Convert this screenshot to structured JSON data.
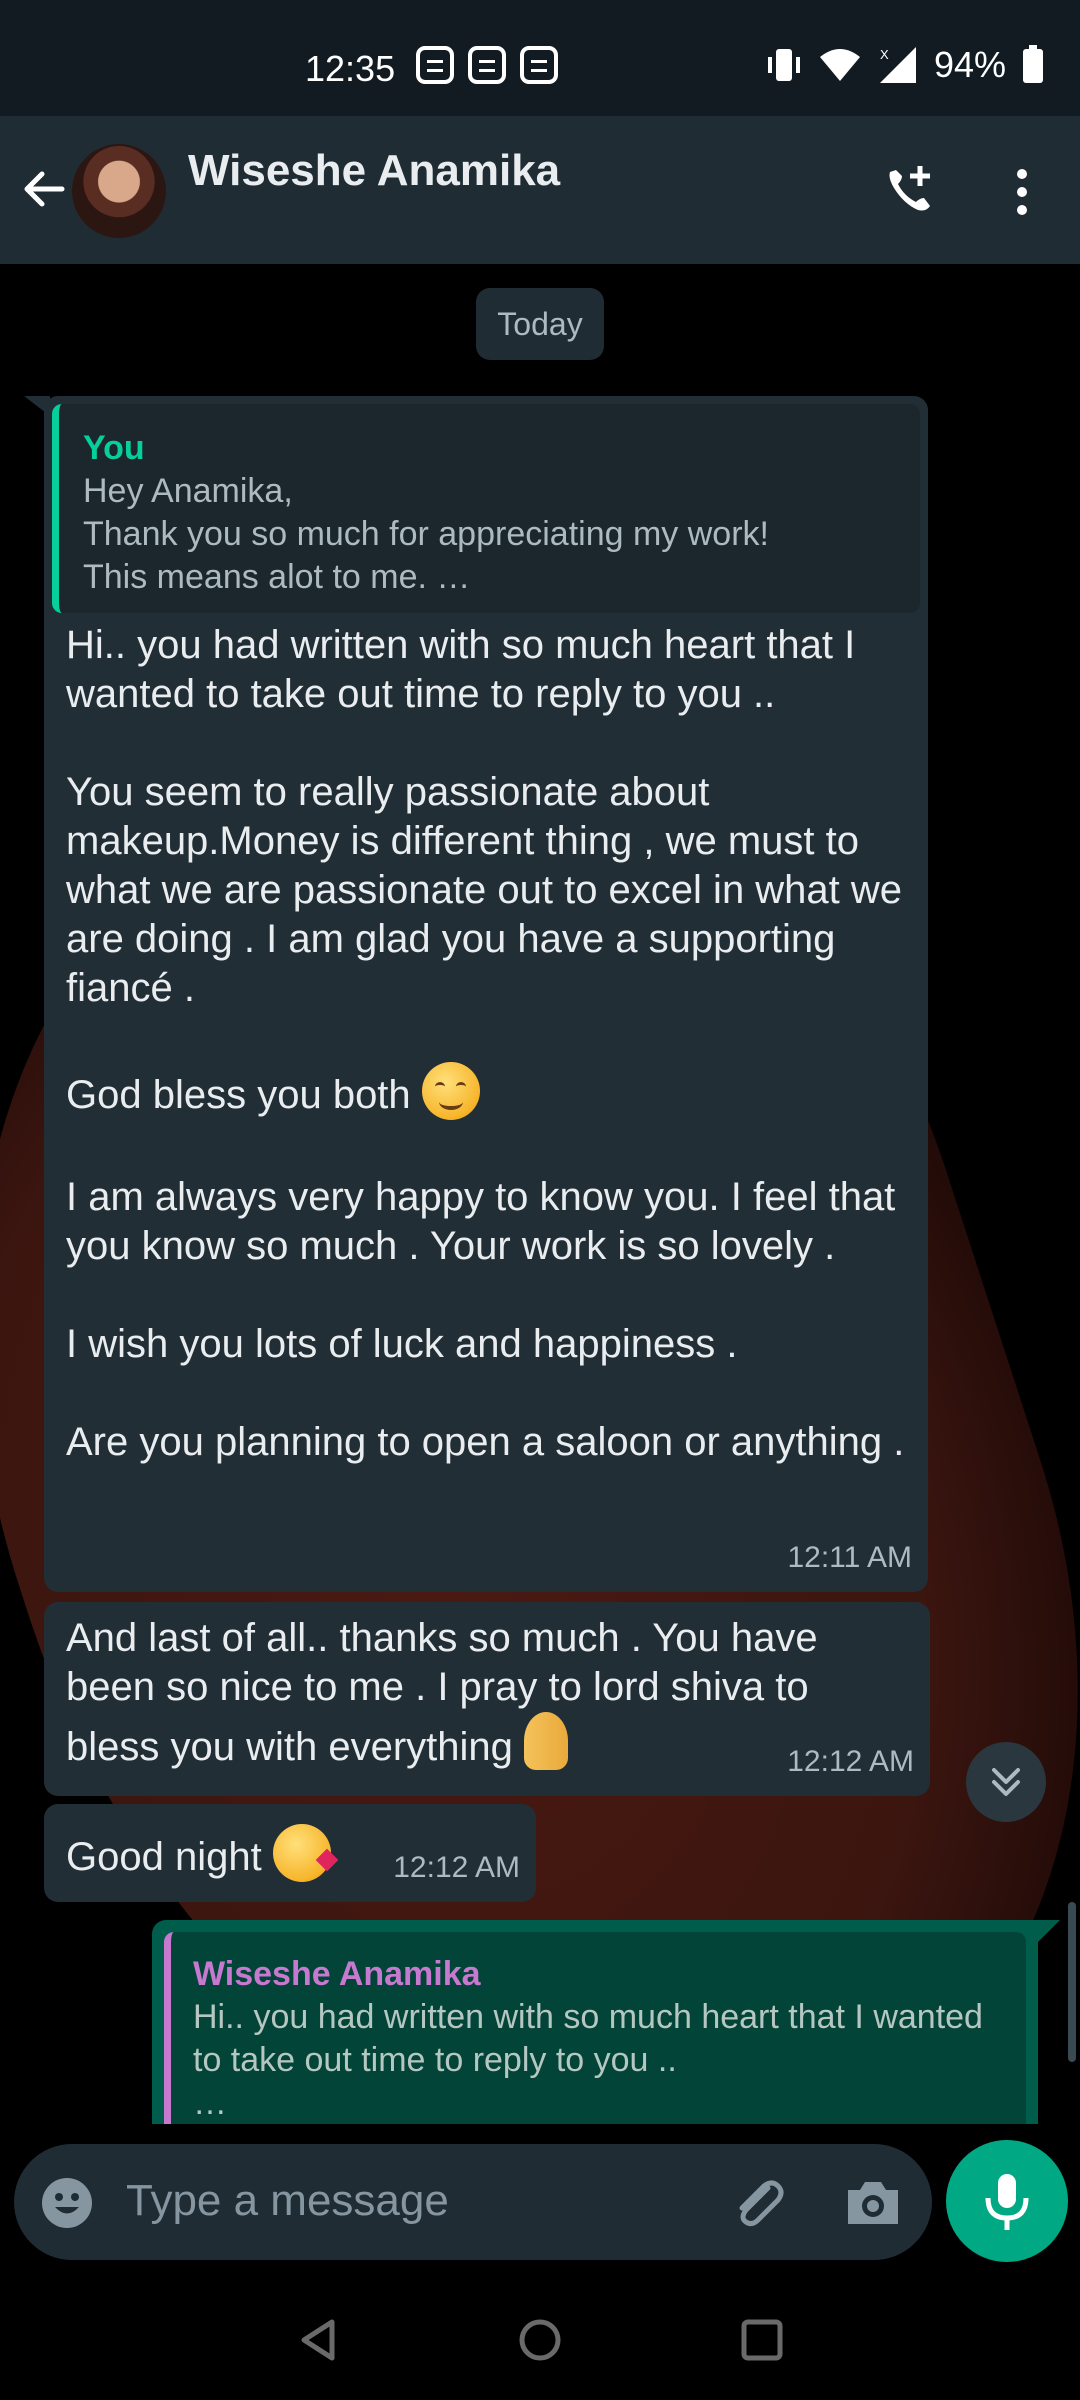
{
  "status_bar": {
    "time": "12:35",
    "battery": "94%"
  },
  "header": {
    "contact_name": "Wiseshe Anamika"
  },
  "chat": {
    "date_label": "Today",
    "msg1": {
      "quote_name": "You",
      "quote_text": "Hey Anamika,\nThank you so much for appreciating my work!\nThis means alot to me. …",
      "text_a": "Hi.. you had written with so much heart that I wanted to take out time to reply to you ..\n\nYou seem to really passionate about makeup.Money is different thing , we must to what we are passionate out to excel in what we are doing . I am glad you have a supporting fiancé .",
      "text_b": "God bless you both",
      "text_c": "I am always very happy to know you. I feel that you know so much . Your work is so lovely .\n\nI wish you lots of luck and happiness .\n\nAre you planning to open a saloon or anything .",
      "time": "12:11 AM"
    },
    "msg2": {
      "text_a": "And last of all.. thanks so much . You have been so nice to me .  I pray to lord shiva to bless you with everything",
      "time": "12:12 AM"
    },
    "msg3": {
      "text": "Good night",
      "time": "12:12 AM"
    },
    "msg4": {
      "quote_name": "Wiseshe Anamika",
      "quote_text": "Hi.. you had written with so much heart that I wanted to take out time to reply to you ..\n…"
    }
  },
  "composer": {
    "placeholder": "Type a message"
  }
}
